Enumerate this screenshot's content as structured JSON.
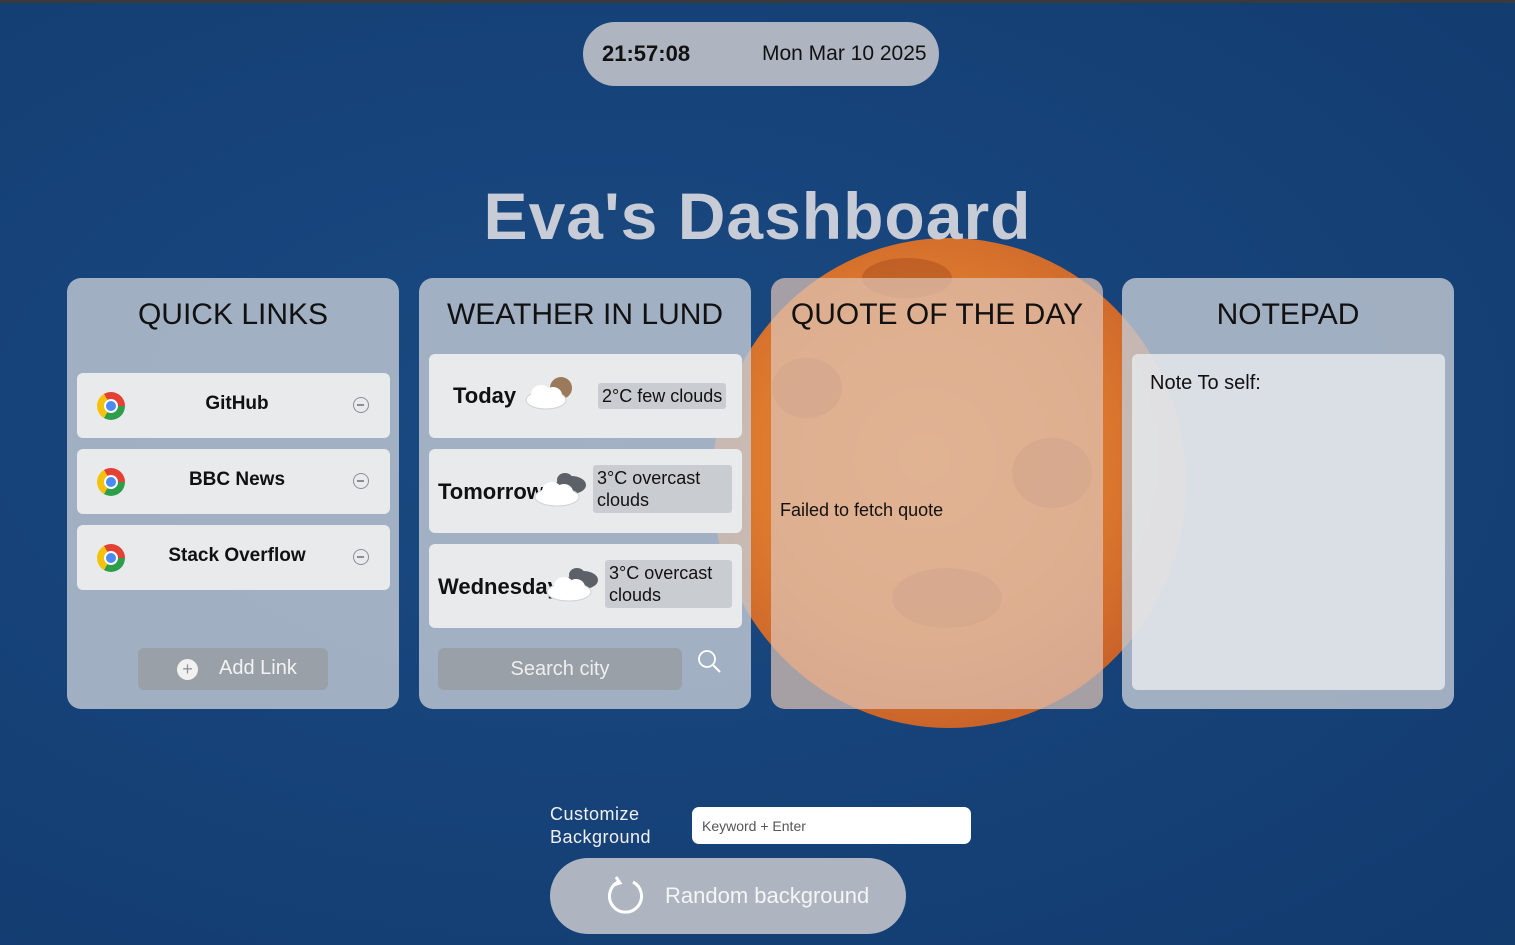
{
  "clock": {
    "time": "21:57:08",
    "date": "Mon Mar 10 2025"
  },
  "title": "Eva's Dashboard",
  "quick_links": {
    "heading": "QUICK LINKS",
    "items": [
      {
        "label": "GitHub",
        "icon": "chrome-icon"
      },
      {
        "label": "BBC News",
        "icon": "chrome-icon"
      },
      {
        "label": "Stack Overflow",
        "icon": "chrome-icon"
      }
    ],
    "add_label": "Add Link"
  },
  "weather": {
    "heading": "WEATHER IN LUND",
    "days": [
      {
        "day": "Today",
        "icon": "few-clouds-icon",
        "desc": "2°C few clouds"
      },
      {
        "day": "Tomorrow",
        "icon": "overcast-clouds-icon",
        "desc_line1": "3°C overcast",
        "desc_line2": "clouds"
      },
      {
        "day": "Wednesday",
        "icon": "overcast-clouds-icon",
        "desc_line1": "3°C overcast",
        "desc_line2": "clouds"
      }
    ],
    "search_placeholder": "Search city"
  },
  "quote": {
    "heading": "QUOTE OF THE DAY",
    "text": "Failed to fetch quote"
  },
  "notepad": {
    "heading": "NOTEPAD",
    "content": "Note To self:"
  },
  "customize": {
    "label_line1": "Customize",
    "label_line2": "Background",
    "placeholder": "Keyword + Enter",
    "random_label": "Random background"
  },
  "colors": {
    "background": "#16437a",
    "moon": "#dd7a2e",
    "panel": "#c4cad4",
    "button": "#9aa0a8"
  }
}
